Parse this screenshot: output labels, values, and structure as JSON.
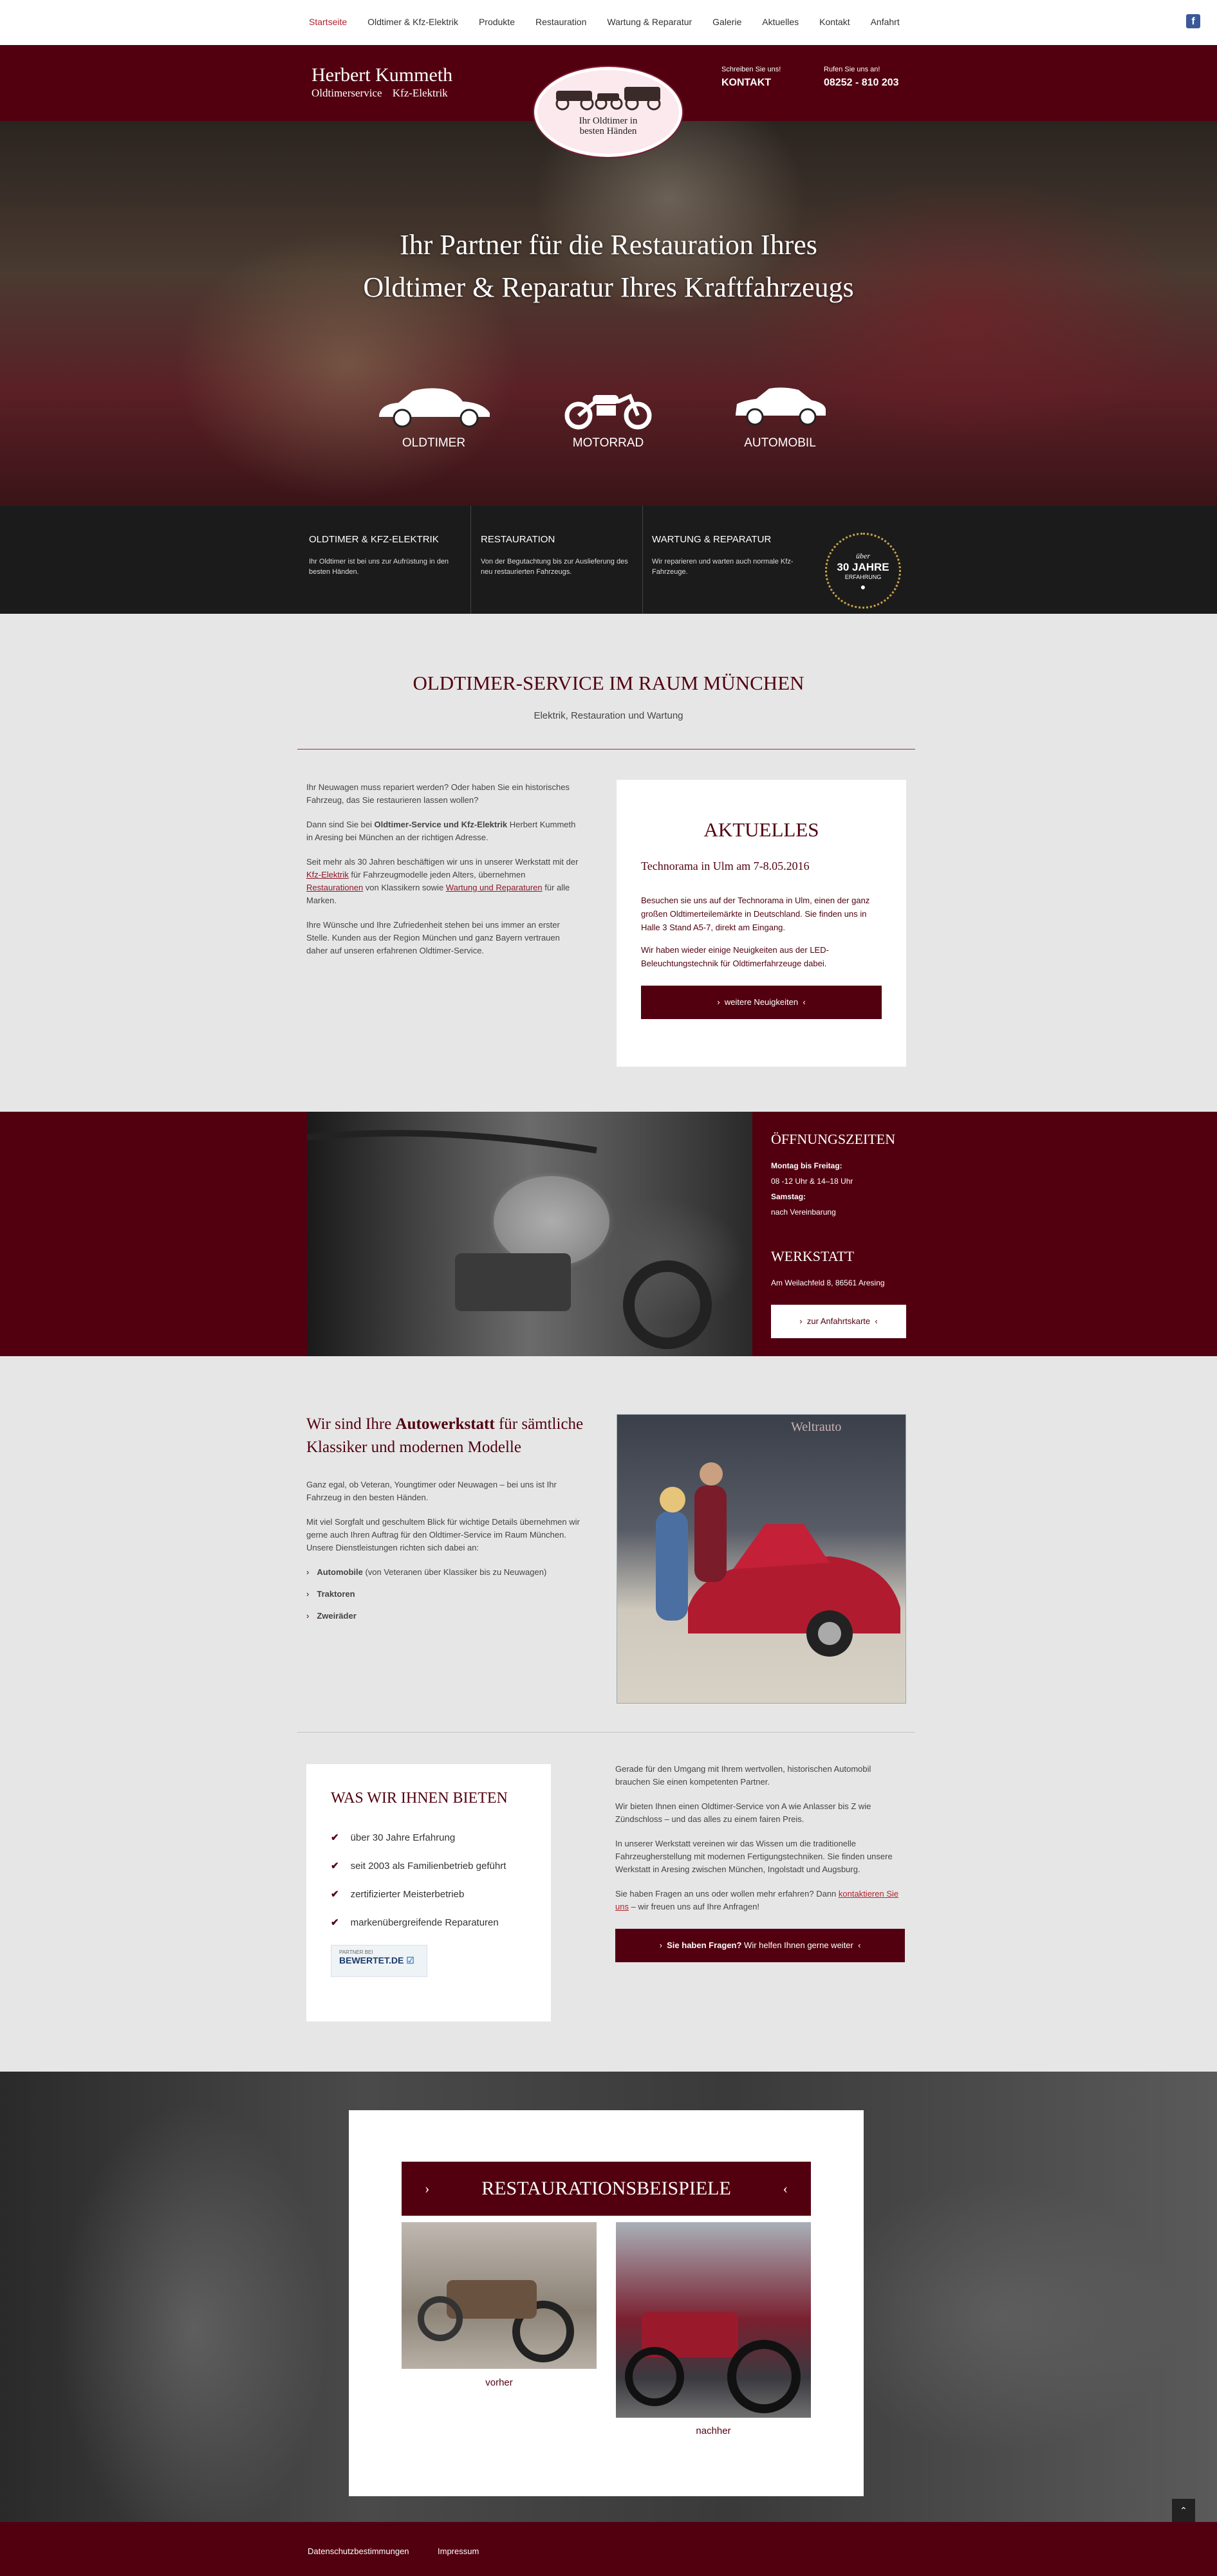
{
  "nav": {
    "items": [
      "Startseite",
      "Oldtimer & Kfz-Elektrik",
      "Produkte",
      "Restauration",
      "Wartung & Reparatur",
      "Galerie",
      "Aktuelles",
      "Kontakt",
      "Anfahrt"
    ],
    "active_color": "#b0242e"
  },
  "header": {
    "brand_name": "Herbert Kummeth",
    "brand_sub": "Oldtimerservice   Kfz-Elektrik",
    "logo_text": "Ihr Oldtimer in besten Händen",
    "contact1_small": "Schreiben Sie uns!",
    "contact1_big": "KONTAKT",
    "contact2_small": "Rufen Sie uns an!",
    "contact2_big": "08252 - 810 203",
    "bg_color": "#520010"
  },
  "hero": {
    "headline_line1": "Ihr Partner für die Restauration Ihres",
    "headline_line2": "Oldtimer & Reparatur Ihres Kraftfahrzeugs",
    "vehicles": [
      "OLDTIMER",
      "MOTORRAD",
      "AUTOMOBIL"
    ]
  },
  "features": [
    {
      "title": "OLDTIMER & KFZ-ELEKTRIK",
      "text": "Ihr Oldtimer ist bei uns zur Aufrüstung in den besten Händen."
    },
    {
      "title": "RESTAURATION",
      "text": "Von der Begutachtung bis zur Auslieferung des neu restaurierten Fahrzeugs."
    },
    {
      "title": "WARTUNG & REPARATUR",
      "text": "Wir reparieren und warten auch normale Kfz-Fahrzeuge."
    }
  ],
  "badge": {
    "line1": "über",
    "line2": "30 JAHRE",
    "line3": "ERFAHRUNG"
  },
  "service": {
    "title": "OLDTIMER-SERVICE IM RAUM MÜNCHEN",
    "subtitle": "Elektrik, Restauration und Wartung",
    "p1": "Ihr Neuwagen muss repariert werden? Oder haben Sie ein historisches Fahrzeug, das Sie restaurieren lassen wollen?",
    "p2_pre": "Dann sind Sie bei ",
    "p2_bold": "Oldtimer-Service und Kfz-Elektrik",
    "p2_post": " Herbert Kummeth in Aresing bei München an der richtigen Adresse.",
    "p3_a": "Seit mehr als 30 Jahren beschäftigen wir uns in unserer Werkstatt mit der ",
    "p3_link1": "Kfz-Elektrik",
    "p3_b": " für Fahrzeugmodelle jeden Alters, übernehmen ",
    "p3_link2": "Restaurationen",
    "p3_c": " von Klassikern sowie ",
    "p3_link3": "Wartung und Reparaturen",
    "p3_d": " für alle Marken.",
    "p4": "Ihre Wünsche und Ihre Zufriedenheit stehen bei uns immer an erster Stelle. Kunden aus der Region München und ganz Bayern vertrauen daher auf unseren erfahrenen Oldtimer-Service."
  },
  "news": {
    "title": "AKTUELLES",
    "headline": "Technorama in Ulm am 7-8.05.2016",
    "p1": "Besuchen sie uns auf der Technorama in Ulm, einen der ganz großen Oldtimerteilemärkte in Deutschland. Sie finden uns in Halle 3 Stand A5-7, direkt am Eingang.",
    "p2": "Wir haben wieder einige Neuigkeiten aus der LED-Beleuchtungstechnik für Oldtimerfahrzeuge dabei.",
    "button": "weitere Neuigkeiten"
  },
  "hours": {
    "title": "ÖFFNUNGSZEITEN",
    "weekday_label": "Montag bis Freitag:",
    "weekday_time": "08 -12 Uhr & 14–18 Uhr",
    "sat_label": "Samstag:",
    "sat_time": "nach Vereinbarung",
    "workshop_title": "WERKSTATT",
    "address": "Am Weilachfeld 8, 86561 Aresing",
    "button": "zur Anfahrtskarte"
  },
  "werkstatt": {
    "heading_pre": "Wir sind Ihre ",
    "heading_bold": "Autowerkstatt",
    "heading_post": " für sämtliche Klassiker und modernen Modelle",
    "p1": "Ganz egal, ob Veteran, Youngtimer oder Neuwagen – bei uns ist Ihr Fahrzeug in den besten Händen.",
    "p2": "Mit viel Sorgfalt und geschultem Blick für wichtige Details übernehmen wir gerne auch Ihren Auftrag für den Oldtimer-Service im Raum München. Unsere Dienstleistungen richten sich dabei an:",
    "list": [
      {
        "bold": "Automobile",
        "rest": " (von Veteranen über Klassiker bis zu Neuwagen)"
      },
      {
        "bold": "Traktoren",
        "rest": ""
      },
      {
        "bold": "Zweiräder",
        "rest": ""
      }
    ],
    "photo_sign": "Weltrauto"
  },
  "offer": {
    "title": "WAS WIR IHNEN BIETEN",
    "items": [
      "über 30 Jahre Erfahrung",
      "seit 2003 als Familienbetrieb geführt",
      "zertifizierter Meisterbetrieb",
      "markenübergreifende Reparaturen"
    ],
    "partner_small": "PARTNER BEI",
    "partner_name": "BEWERTET.DE"
  },
  "more": {
    "p1": "Gerade für den Umgang mit Ihrem wertvollen, historischen Automobil brauchen Sie einen kompetenten Partner.",
    "p2": "Wir bieten Ihnen einen Oldtimer-Service von A wie Anlasser bis Z wie Zündschloss – und das alles zu einem fairen Preis.",
    "p3": "In unserer Werkstatt vereinen wir das Wissen um die traditionelle Fahrzeugherstellung mit modernen Fertigungstechniken. Sie finden unsere Werkstatt in Aresing zwischen München, Ingolstadt und Augsburg.",
    "p4_pre": "Sie haben Fragen an uns oder wollen mehr erfahren? Dann ",
    "p4_link": "kontaktieren Sie uns",
    "p4_post": " – wir freuen uns auf Ihre Anfragen!",
    "button_bold": "Sie haben Fragen?",
    "button_rest": " Wir helfen Ihnen gerne weiter"
  },
  "resto": {
    "title": "RESTAURATIONSBEISPIELE",
    "before": "vorher",
    "after": "nachher"
  },
  "footer": {
    "links": [
      "Datenschutzbestimmungen",
      "Impressum"
    ]
  }
}
